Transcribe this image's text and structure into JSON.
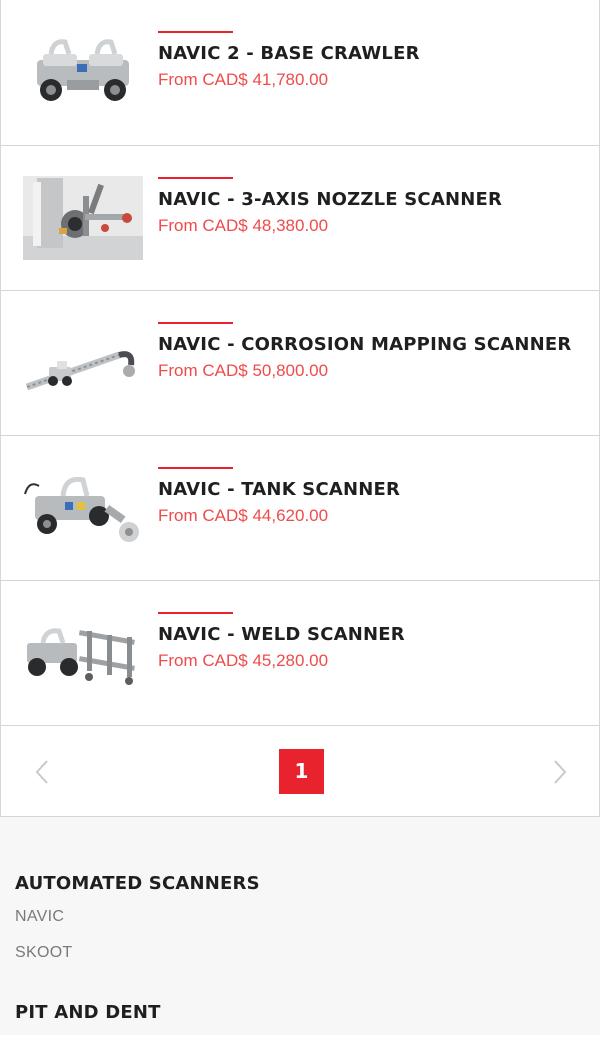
{
  "products": [
    {
      "title": "NAVIC 2 - BASE CRAWLER",
      "price": "From CAD$ 41,780.00",
      "image_icon": "base-crawler-image"
    },
    {
      "title": "NAVIC - 3-AXIS NOZZLE SCANNER",
      "price": "From CAD$ 48,380.00",
      "image_icon": "nozzle-scanner-image"
    },
    {
      "title": "NAVIC - CORROSION MAPPING SCANNER",
      "price": "From CAD$ 50,800.00",
      "image_icon": "corrosion-scanner-image"
    },
    {
      "title": "NAVIC - TANK SCANNER",
      "price": "From CAD$ 44,620.00",
      "image_icon": "tank-scanner-image"
    },
    {
      "title": "NAVIC - WELD SCANNER",
      "price": "From CAD$ 45,280.00",
      "image_icon": "weld-scanner-image"
    }
  ],
  "pagination": {
    "current_page": "1",
    "prev_icon": "chevron-left-icon",
    "next_icon": "chevron-right-icon"
  },
  "sidebar": {
    "categories": [
      {
        "title": "AUTOMATED SCANNERS",
        "links": [
          "NAVIC",
          "SKOOT"
        ]
      },
      {
        "title": "PIT AND DENT",
        "links": []
      }
    ]
  },
  "colors": {
    "accent": "#e8232e",
    "price": "#ef4b4b",
    "border": "#d6d6d6",
    "sidebar_bg": "#f7f7f7"
  }
}
